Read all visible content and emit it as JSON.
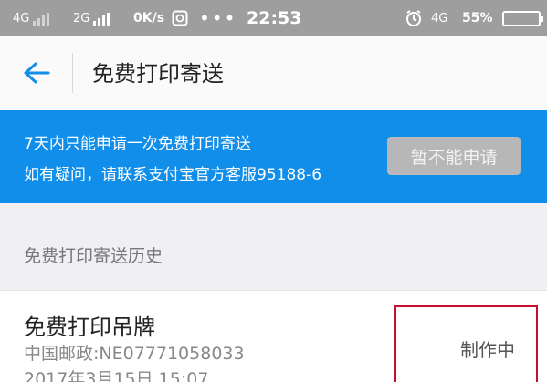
{
  "status_bar": {
    "sim1": "4G",
    "sim2": "2G",
    "speed": "0K/s",
    "time": "22:53",
    "net": "4G",
    "battery": "55%"
  },
  "header": {
    "title": "免费打印寄送"
  },
  "banner": {
    "line1": "7天内只能申请一次免费打印寄送",
    "line2": "如有疑问，请联系支付宝官方客服95188-6",
    "button_label": "暂不能申请"
  },
  "history": {
    "section_label": "免费打印寄送历史",
    "items": [
      {
        "title": "免费打印吊牌",
        "tracking": "中国邮政:NE07771058033",
        "date": "2017年3月15日 15:07",
        "status": "制作中"
      }
    ]
  },
  "colors": {
    "accent": "#108ee9",
    "status_bar": "#9e9e9e",
    "highlight_box": "#c8102e"
  }
}
